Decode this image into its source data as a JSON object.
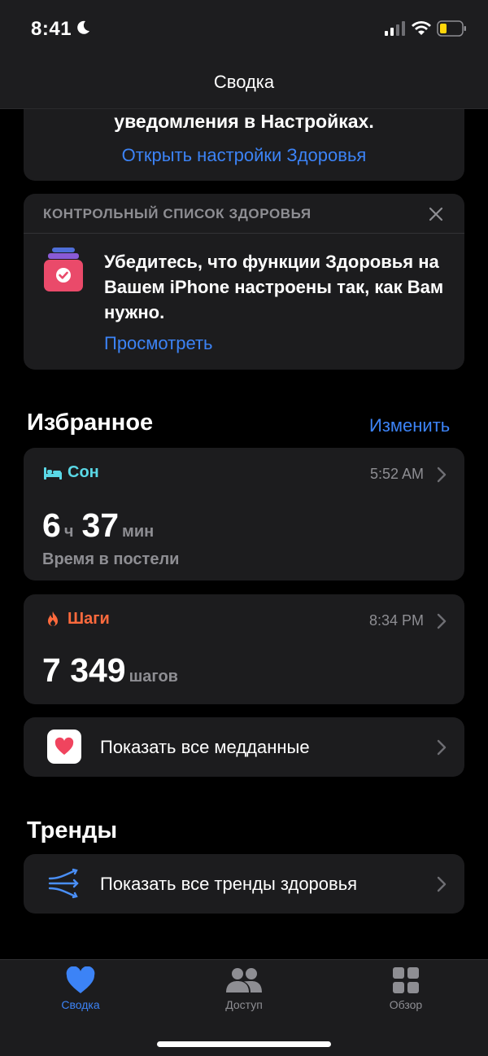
{
  "status_bar": {
    "time": "8:41"
  },
  "nav": {
    "title": "Сводка"
  },
  "notification_card": {
    "text": "уведомления в Настройках.",
    "link": "Открыть настройки Здоровья"
  },
  "checklist": {
    "header": "КОНТРОЛЬНЫЙ СПИСОК ЗДОРОВЬЯ",
    "body": "Убедитесь, что функции Здоровья на Вашем iPhone настроены так, как Вам нужно.",
    "link": "Просмотреть"
  },
  "favorites": {
    "title": "Избранное",
    "edit": "Изменить",
    "sleep": {
      "label": "Сон",
      "time": "5:52 AM",
      "hours": "6",
      "hours_unit": "ч",
      "minutes": "37",
      "minutes_unit": "мин",
      "sub": "Время в постели"
    },
    "steps": {
      "label": "Шаги",
      "time": "8:34 PM",
      "value": "7 349",
      "unit": "шагов"
    },
    "show_all": "Показать все медданные"
  },
  "trends": {
    "title": "Тренды",
    "show_all": "Показать все тренды здоровья"
  },
  "tabs": [
    {
      "label": "Сводка",
      "active": true
    },
    {
      "label": "Доступ",
      "active": false
    },
    {
      "label": "Обзор",
      "active": false
    }
  ],
  "colors": {
    "accent": "#3c83f6",
    "sleep": "#5ad8e6",
    "steps": "#ff6a3d",
    "card": "#1c1c1e"
  }
}
